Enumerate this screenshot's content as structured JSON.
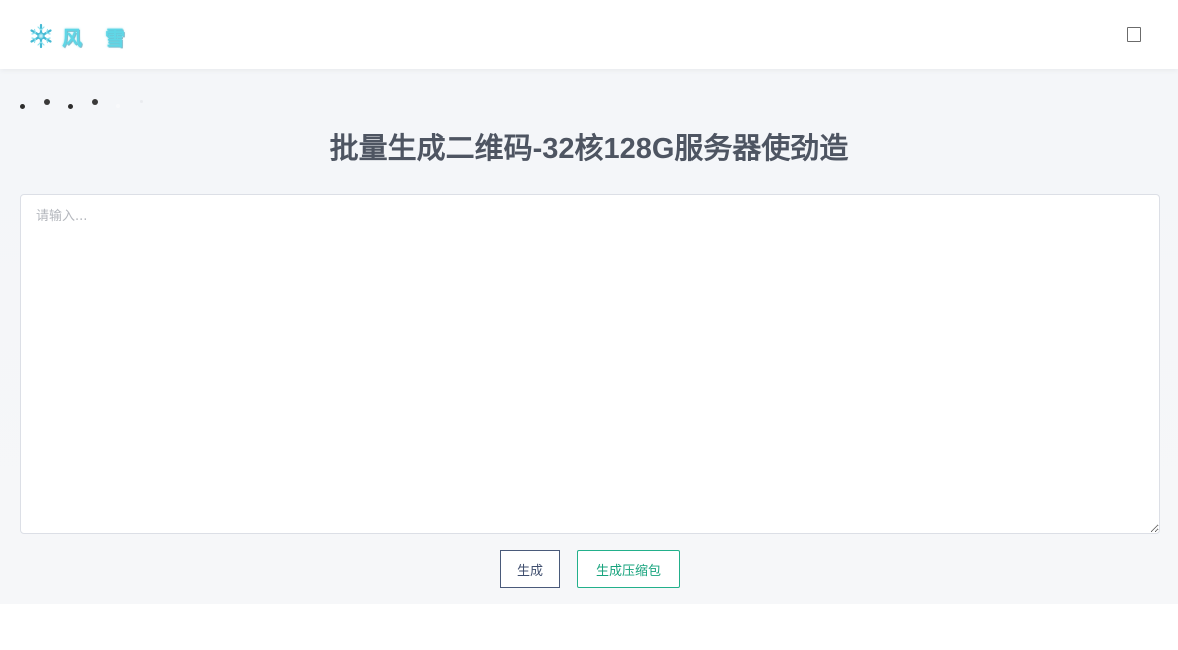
{
  "header": {
    "logo_text": "风 雪",
    "logo_icon": "snowflake-icon",
    "menu_icon": "menu-icon"
  },
  "main": {
    "title": "批量生成二维码-32核128G服务器使劲造",
    "input": {
      "placeholder": "请输入...",
      "value": ""
    },
    "buttons": {
      "generate_label": "生成",
      "generate_zip_label": "生成压缩包"
    }
  },
  "colors": {
    "title": "#4e5562",
    "logo": "#5fd6e6",
    "generate_button_border": "#4a5a7a",
    "zip_button_border": "#22b08b",
    "zip_button_text": "#17a37d",
    "page_background": "#f4f6f9"
  }
}
